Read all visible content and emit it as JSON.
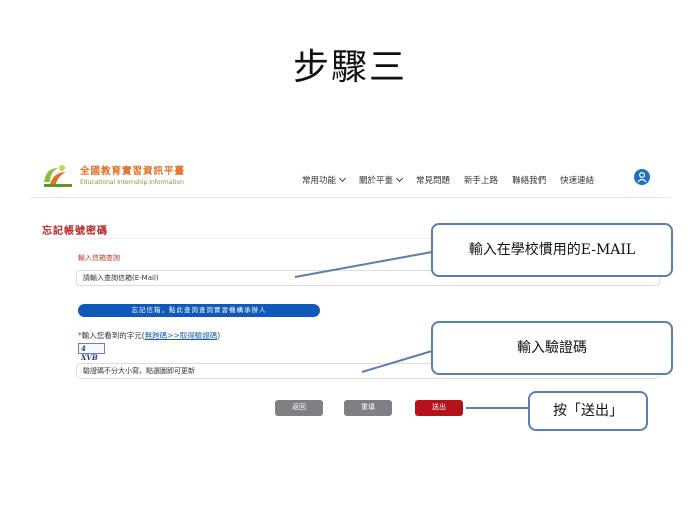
{
  "slide": {
    "title": "步驟三"
  },
  "header": {
    "brand_main": "全國教育實習資訊平臺",
    "brand_sub": "Educational Internship Information",
    "nav": [
      {
        "label": "常用功能",
        "dropdown": true
      },
      {
        "label": "關於平臺",
        "dropdown": true
      },
      {
        "label": "常見問題",
        "dropdown": false
      },
      {
        "label": "新手上路",
        "dropdown": false
      },
      {
        "label": "聯絡我們",
        "dropdown": false
      },
      {
        "label": "快速連結",
        "dropdown": false
      }
    ]
  },
  "form": {
    "heading": "忘記帳號密碼",
    "email_label": "輸入信箱查詢",
    "email_placeholder": "請輸入查詢信箱(E-Mail)",
    "banner": "忘記信箱，點此查詢查詢實習機構承辦人",
    "captcha_label_prefix": "輸入您看到的字元(",
    "captcha_link": "無跨碼>>取得驗證碼",
    "captcha_label_suffix": ")",
    "captcha_image_text": "4 XVB",
    "captcha_placeholder": "驗證碼不分大小寫，點選圖即可更新",
    "buttons": {
      "back": "返回",
      "clear": "重填",
      "submit": "送出"
    }
  },
  "callouts": {
    "email": "輸入在學校慣用的E-MAIL",
    "captcha": "輸入驗證碼",
    "submit": "按「送出」"
  },
  "colors": {
    "brand_orange": "#e0712a",
    "heading_red": "#b82525",
    "banner_blue": "#1059b8",
    "submit_red": "#b5121b",
    "callout_border": "#5b7fb1"
  }
}
